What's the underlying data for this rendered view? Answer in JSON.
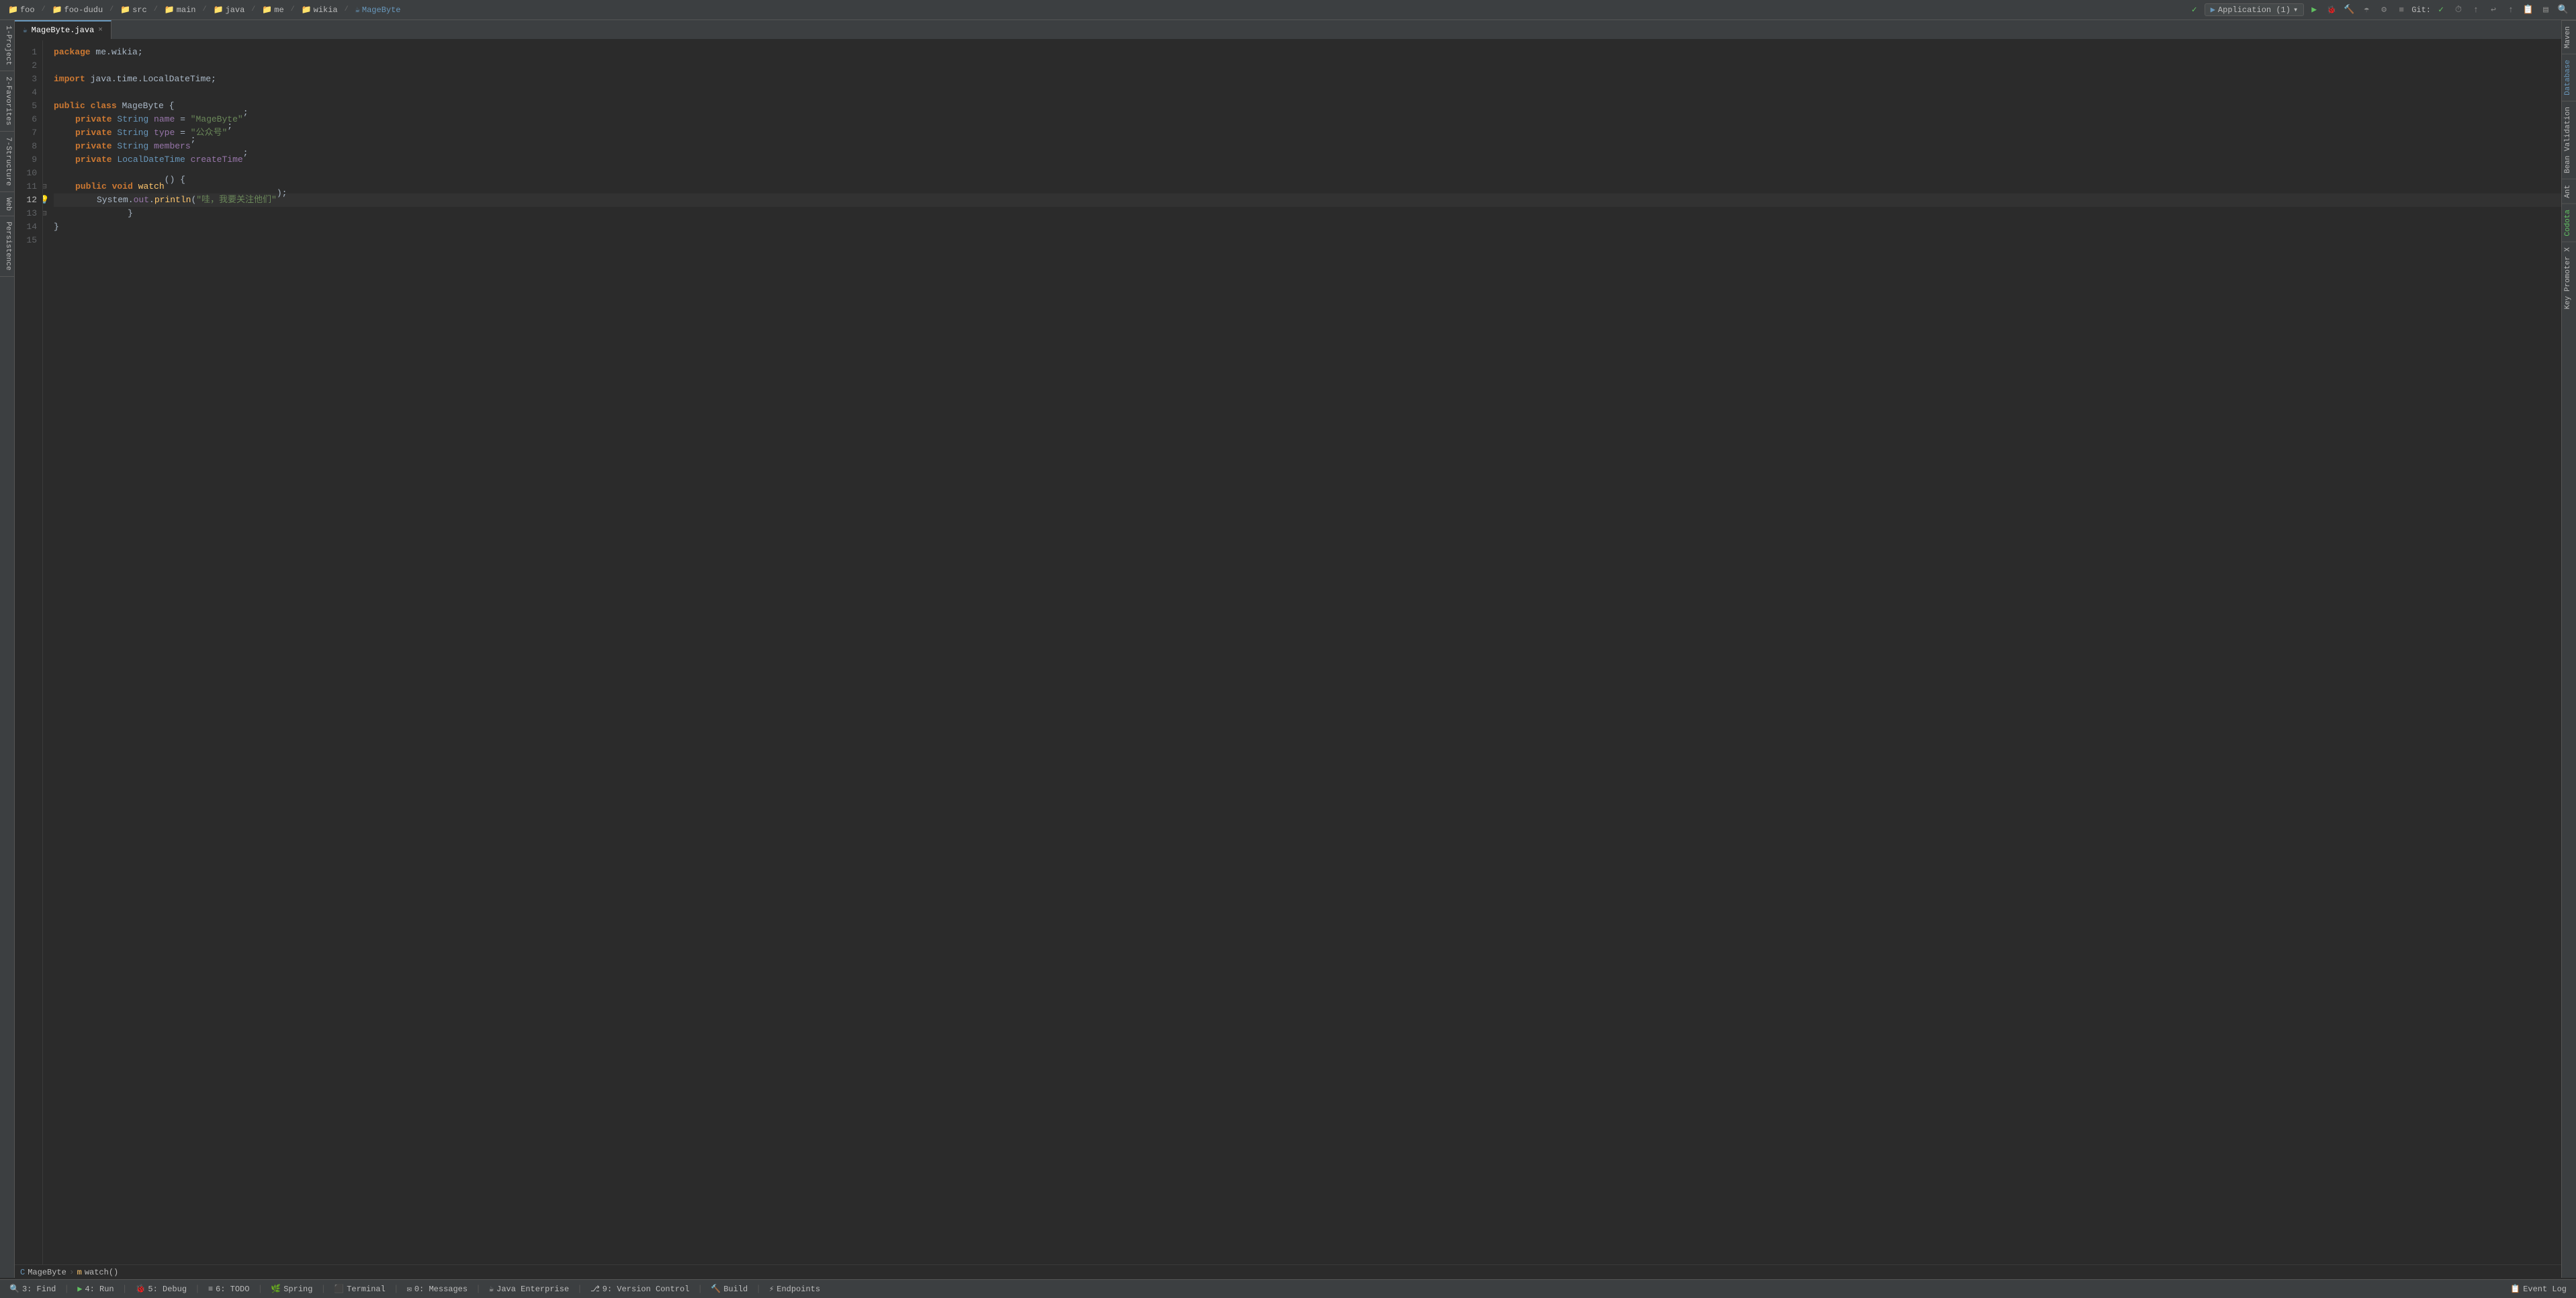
{
  "topnav": {
    "breadcrumbs": [
      "foo",
      "foo-dudu",
      "src",
      "main",
      "java",
      "me",
      "wikia",
      "MageByte"
    ],
    "run_config": "Application (1)",
    "git_label": "Git:"
  },
  "editor": {
    "file_tab": "MageByte.java",
    "lines": [
      {
        "num": 1,
        "content": "package me.wikia;",
        "type": "package"
      },
      {
        "num": 2,
        "content": "",
        "type": "empty"
      },
      {
        "num": 3,
        "content": "import java.time.LocalDateTime;",
        "type": "import"
      },
      {
        "num": 4,
        "content": "",
        "type": "empty"
      },
      {
        "num": 5,
        "content": "public class MageByte {",
        "type": "class"
      },
      {
        "num": 6,
        "content": "    private String name = \"MageByte\";",
        "type": "field"
      },
      {
        "num": 7,
        "content": "    private String type = \"公众号\";",
        "type": "field"
      },
      {
        "num": 8,
        "content": "    private String members;",
        "type": "field"
      },
      {
        "num": 9,
        "content": "    private LocalDateTime createTime;",
        "type": "field"
      },
      {
        "num": 10,
        "content": "",
        "type": "empty"
      },
      {
        "num": 11,
        "content": "    public void watch() {",
        "type": "method"
      },
      {
        "num": 12,
        "content": "        System.out.println(\"哇，我要关注他们\");",
        "type": "statement",
        "active": true
      },
      {
        "num": 13,
        "content": "    }",
        "type": "close"
      },
      {
        "num": 14,
        "content": "}",
        "type": "close"
      },
      {
        "num": 15,
        "content": "",
        "type": "empty"
      }
    ]
  },
  "breadcrumb": {
    "class": "MageByte",
    "method": "watch()"
  },
  "sidebar_left": {
    "tabs": [
      "1-Project",
      "2-Favorites",
      "3-Structure",
      "Web",
      "Persistence"
    ]
  },
  "sidebar_right": {
    "tabs": [
      "Maven",
      "Database",
      "Bean Validation",
      "Ant",
      "Codota",
      "Key Promoter X"
    ]
  },
  "status_bar": {
    "items": [
      "3: Find",
      "4: Run",
      "5: Debug",
      "6: TODO",
      "Spring",
      "Terminal",
      "0: Messages",
      "Java Enterprise",
      "9: Version Control",
      "Build",
      "Endpoints",
      "Event Log"
    ]
  },
  "toolbar": {
    "run": "▶",
    "debug": "🐞",
    "build": "🔨",
    "stop": "■",
    "profile": "⚙",
    "coverage": "✓",
    "git_check": "✓",
    "git_timer": "⏱",
    "git_undo": "↩",
    "git_push": "↑"
  }
}
